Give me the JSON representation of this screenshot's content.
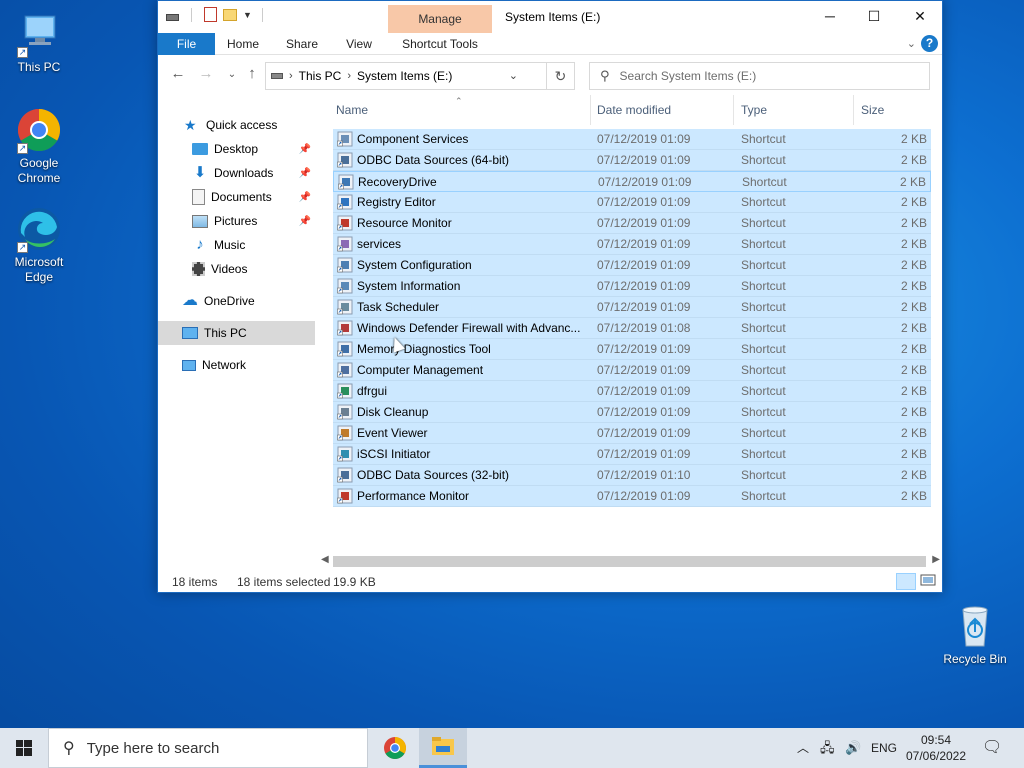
{
  "desktop": {
    "icons": [
      {
        "label": "This PC"
      },
      {
        "label": "Google Chrome"
      },
      {
        "label": "Microsoft Edge"
      },
      {
        "label": "Recycle Bin"
      }
    ]
  },
  "window": {
    "title": "System Items (E:)",
    "context_tab": "Manage",
    "ribbon_tabs": [
      "File",
      "Home",
      "Share",
      "View",
      "Shortcut Tools"
    ],
    "address": {
      "segments": [
        "This PC",
        "System Items (E:)"
      ]
    },
    "search_placeholder": "Search System Items (E:)",
    "nav_pane": {
      "quick_access": "Quick access",
      "items": [
        {
          "label": "Desktop",
          "pinned": true
        },
        {
          "label": "Downloads",
          "pinned": true
        },
        {
          "label": "Documents",
          "pinned": true
        },
        {
          "label": "Pictures",
          "pinned": true
        },
        {
          "label": "Music",
          "pinned": false
        },
        {
          "label": "Videos",
          "pinned": false
        }
      ],
      "onedrive": "OneDrive",
      "this_pc": "This PC",
      "network": "Network"
    },
    "columns": {
      "name": "Name",
      "date": "Date modified",
      "type": "Type",
      "size": "Size"
    },
    "files": [
      {
        "name": "Component Services",
        "date": "07/12/2019 01:09",
        "type": "Shortcut",
        "size": "2 KB"
      },
      {
        "name": "ODBC Data Sources (64-bit)",
        "date": "07/12/2019 01:09",
        "type": "Shortcut",
        "size": "2 KB"
      },
      {
        "name": "RecoveryDrive",
        "date": "07/12/2019 01:09",
        "type": "Shortcut",
        "size": "2 KB"
      },
      {
        "name": "Registry Editor",
        "date": "07/12/2019 01:09",
        "type": "Shortcut",
        "size": "2 KB"
      },
      {
        "name": "Resource Monitor",
        "date": "07/12/2019 01:09",
        "type": "Shortcut",
        "size": "2 KB"
      },
      {
        "name": "services",
        "date": "07/12/2019 01:09",
        "type": "Shortcut",
        "size": "2 KB"
      },
      {
        "name": "System Configuration",
        "date": "07/12/2019 01:09",
        "type": "Shortcut",
        "size": "2 KB"
      },
      {
        "name": "System Information",
        "date": "07/12/2019 01:09",
        "type": "Shortcut",
        "size": "2 KB"
      },
      {
        "name": "Task Scheduler",
        "date": "07/12/2019 01:09",
        "type": "Shortcut",
        "size": "2 KB"
      },
      {
        "name": "Windows Defender Firewall with Advanc...",
        "date": "07/12/2019 01:08",
        "type": "Shortcut",
        "size": "2 KB"
      },
      {
        "name": "Memory Diagnostics Tool",
        "date": "07/12/2019 01:09",
        "type": "Shortcut",
        "size": "2 KB"
      },
      {
        "name": "Computer Management",
        "date": "07/12/2019 01:09",
        "type": "Shortcut",
        "size": "2 KB"
      },
      {
        "name": "dfrgui",
        "date": "07/12/2019 01:09",
        "type": "Shortcut",
        "size": "2 KB"
      },
      {
        "name": "Disk Cleanup",
        "date": "07/12/2019 01:09",
        "type": "Shortcut",
        "size": "2 KB"
      },
      {
        "name": "Event Viewer",
        "date": "07/12/2019 01:09",
        "type": "Shortcut",
        "size": "2 KB"
      },
      {
        "name": "iSCSI Initiator",
        "date": "07/12/2019 01:09",
        "type": "Shortcut",
        "size": "2 KB"
      },
      {
        "name": "ODBC Data Sources (32-bit)",
        "date": "07/12/2019 01:10",
        "type": "Shortcut",
        "size": "2 KB"
      },
      {
        "name": "Performance Monitor",
        "date": "07/12/2019 01:09",
        "type": "Shortcut",
        "size": "2 KB"
      }
    ],
    "status": {
      "count": "18 items",
      "selected": "18 items selected",
      "size": "19.9 KB"
    }
  },
  "taskbar": {
    "search_placeholder": "Type here to search",
    "language": "ENG",
    "time": "09:54",
    "date": "07/06/2022"
  },
  "colors": {
    "selection": "#cce8ff",
    "accent": "#1979ca",
    "manage_tab": "#f8c8a8"
  }
}
